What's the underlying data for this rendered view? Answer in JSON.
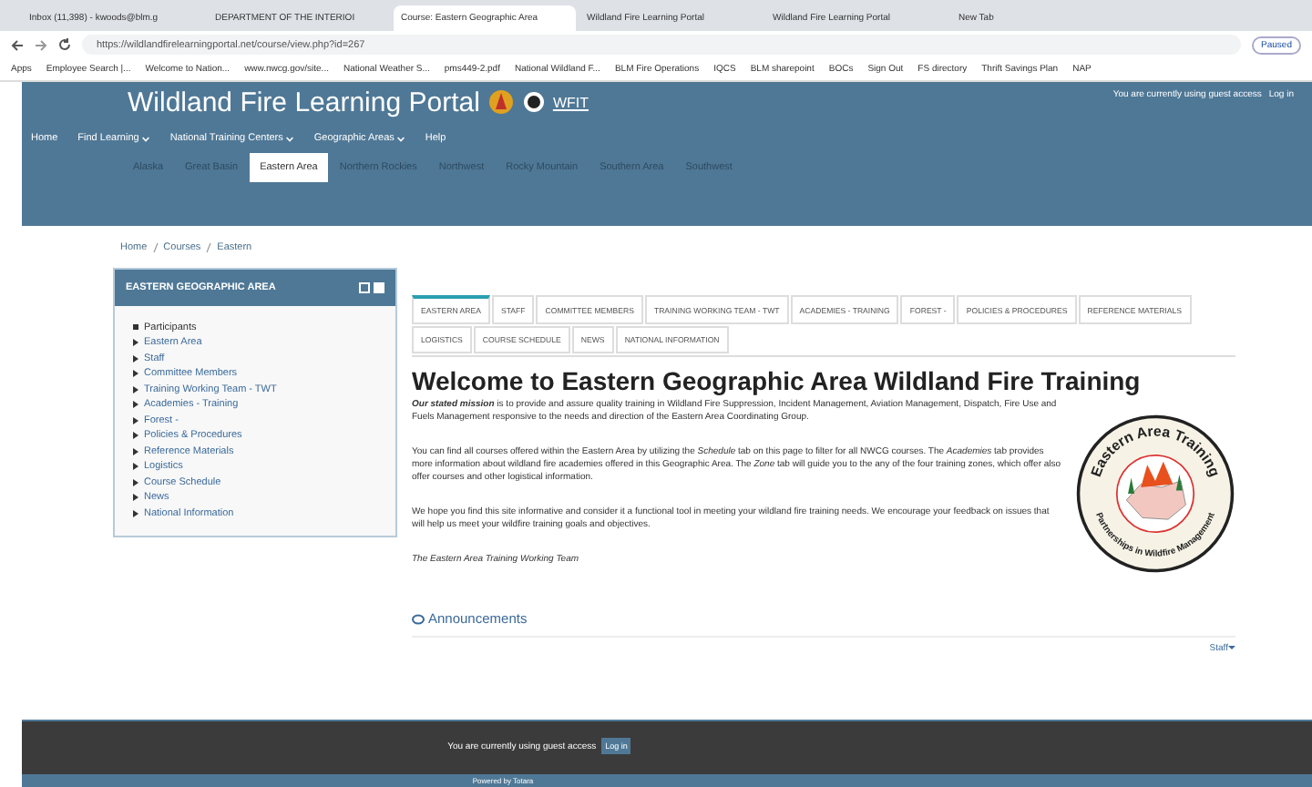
{
  "browser": {
    "tabs": [
      {
        "title": "Inbox (11,398) - kwoods@blm.g",
        "selected": false
      },
      {
        "title": "DEPARTMENT OF THE INTERIOI",
        "selected": false
      },
      {
        "title": "Course: Eastern Geographic Area",
        "selected": true
      },
      {
        "title": "Wildland Fire Learning Portal",
        "selected": false
      },
      {
        "title": "Wildland Fire Learning Portal",
        "selected": false
      },
      {
        "title": "New Tab",
        "selected": false
      }
    ],
    "url_host": "https://wildlandfirelearningportal.net",
    "url_path": "/course/view.php?id=267",
    "profile": "Paused",
    "bookmarks": [
      "Apps",
      "Employee Search |...",
      "Welcome to Nation...",
      "www.nwcg.gov/site...",
      "National Weather S...",
      "pms449-2.pdf",
      "National Wildland F...",
      "BLM Fire Operations",
      "IQCS",
      "BLM sharepoint",
      "BOCs",
      "Sign Out",
      "FS directory",
      "Thrift Savings Plan",
      "NAP"
    ]
  },
  "header": {
    "site_title": "Wildland Fire Learning Portal",
    "logo_text": "WFIT",
    "guest_notice": "You are currently using guest access",
    "login": "Log in",
    "nav": [
      {
        "label": "Home",
        "dropdown": false
      },
      {
        "label": "Find Learning",
        "dropdown": true
      },
      {
        "label": "National Training Centers",
        "dropdown": true
      },
      {
        "label": "Geographic Areas",
        "dropdown": true
      },
      {
        "label": "Help",
        "dropdown": false
      }
    ],
    "areas": [
      {
        "label": "Alaska",
        "selected": false
      },
      {
        "label": "Great Basin",
        "selected": false
      },
      {
        "label": "Eastern Area",
        "selected": true
      },
      {
        "label": "Northern Rockies",
        "selected": false
      },
      {
        "label": "Northwest",
        "selected": false
      },
      {
        "label": "Rocky Mountain",
        "selected": false
      },
      {
        "label": "Southern Area",
        "selected": false
      },
      {
        "label": "Southwest",
        "selected": false
      }
    ]
  },
  "breadcrumb": [
    "Home",
    "Courses",
    "Eastern"
  ],
  "sidebar": {
    "title": "EASTERN GEOGRAPHIC AREA",
    "items": [
      {
        "label": "Participants",
        "kind": "bullet"
      },
      {
        "label": "Eastern Area",
        "kind": "link"
      },
      {
        "label": "Staff",
        "kind": "link"
      },
      {
        "label": "Committee Members",
        "kind": "link"
      },
      {
        "label": "Training Working Team - TWT",
        "kind": "link"
      },
      {
        "label": "Academies - Training",
        "kind": "link"
      },
      {
        "label": "Forest -",
        "kind": "link"
      },
      {
        "label": "Policies & Procedures",
        "kind": "link"
      },
      {
        "label": "Reference Materials",
        "kind": "link"
      },
      {
        "label": "Logistics",
        "kind": "link"
      },
      {
        "label": "Course Schedule",
        "kind": "link"
      },
      {
        "label": "News",
        "kind": "link"
      },
      {
        "label": "National Information",
        "kind": "link"
      }
    ]
  },
  "content_tabs": [
    {
      "label": "EASTERN AREA",
      "selected": true
    },
    {
      "label": "STAFF",
      "selected": false
    },
    {
      "label": "COMMITTEE MEMBERS",
      "selected": false
    },
    {
      "label": "TRAINING WORKING TEAM - TWT",
      "selected": false
    },
    {
      "label": "ACADEMIES - TRAINING",
      "selected": false
    },
    {
      "label": "FOREST -",
      "selected": false
    },
    {
      "label": "POLICIES & PROCEDURES",
      "selected": false
    },
    {
      "label": "REFERENCE MATERIALS",
      "selected": false
    },
    {
      "label": "LOGISTICS",
      "selected": false
    },
    {
      "label": "COURSE SCHEDULE",
      "selected": false
    },
    {
      "label": "NEWS",
      "selected": false
    },
    {
      "label": "NATIONAL INFORMATION",
      "selected": false
    }
  ],
  "heading": "Welcome to Eastern Geographic Area Wildland Fire Training",
  "paragraphs": [
    "**Our stated mission** is to provide and assure quality training in Wildland Fire Suppression, Incident Management, Aviation Management, Dispatch, Fire Use and Fuels Management responsive to the needs and direction of the Eastern Area Coordinating Group.",
    "You can find all courses offered within the Eastern Area by utilizing the *Schedule* tab on this page to filter for all NWCG courses.  The *Academies* tab provides more information about wildland fire academies offered in this Geographic Area.  The *Zone* tab will guide you to the any of the four training zones, which offer also offer courses and other logistical information.",
    "We hope you find this site informative and consider it a functional tool in meeting your wildland fire training needs.  We encourage your feedback on issues that will help us meet your wildfire training goals and objectives."
  ],
  "signature": "The Eastern Area Training Working Team",
  "seal": {
    "top_text": "Eastern Area Training",
    "bottom_text": "Partnerships in Wildfire Management"
  },
  "announcements": "Announcements",
  "staff_menu": "Staff",
  "footer": {
    "guest_notice": "You are currently using guest access",
    "login": "Log in",
    "powered": "Powered by Totara"
  }
}
